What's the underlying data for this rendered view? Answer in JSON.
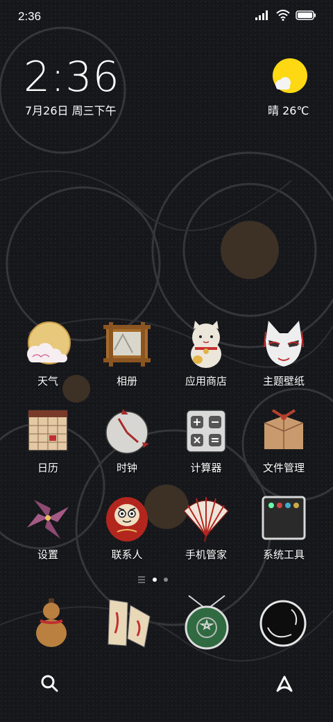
{
  "status_bar": {
    "time": "2:36"
  },
  "clock": {
    "time": "2:36",
    "date": "7月26日 周三下午"
  },
  "weather": {
    "text": "晴 26℃"
  },
  "apps": [
    {
      "label": "天气"
    },
    {
      "label": "相册"
    },
    {
      "label": "应用商店"
    },
    {
      "label": "主题壁纸"
    },
    {
      "label": "日历"
    },
    {
      "label": "时钟"
    },
    {
      "label": "计算器"
    },
    {
      "label": "文件管理"
    },
    {
      "label": "设置"
    },
    {
      "label": "联系人"
    },
    {
      "label": "手机管家"
    },
    {
      "label": "系统工具"
    }
  ],
  "dock": [
    "gourd-icon",
    "scroll-icon",
    "jade-icon",
    "camera-lens-icon"
  ],
  "colors": {
    "background": "#15171b",
    "pattern": "#3a3a3c",
    "flower": "#5a4530",
    "sun": "#ffd814"
  }
}
